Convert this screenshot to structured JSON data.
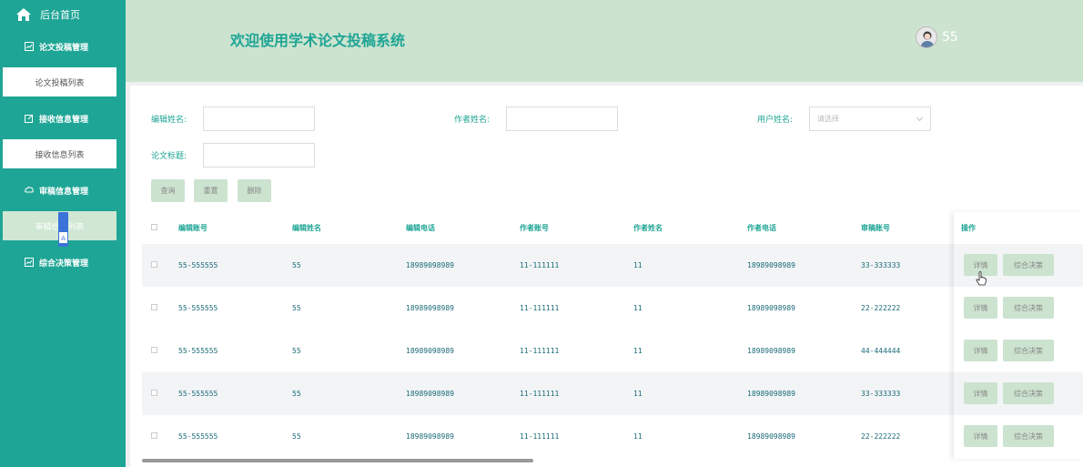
{
  "sidebar": {
    "home": "后台首页",
    "groups": [
      {
        "label": "论文投稿管理",
        "sub": "论文投稿列表"
      },
      {
        "label": "接收信息管理",
        "sub": "接收信息列表"
      },
      {
        "label": "审稿信息管理",
        "sub": "审稿信息列表"
      },
      {
        "label": "综合决策管理"
      }
    ]
  },
  "header": {
    "title": "欢迎使用学术论文投稿系统",
    "username": "55"
  },
  "filters": {
    "editor_name": "编辑姓名:",
    "author_name": "作者姓名:",
    "user_name": "用户姓名:",
    "user_name_placeholder": "请选择",
    "paper_title": "论文标题:"
  },
  "buttons": {
    "query": "查询",
    "reset": "重置",
    "delete": "删除"
  },
  "table": {
    "headers": [
      "编辑账号",
      "编辑姓名",
      "编辑电话",
      "作者账号",
      "作者姓名",
      "作者电话",
      "审稿账号"
    ],
    "ops_header": "操作",
    "detail": "详情",
    "decision": "综合决策",
    "rows": [
      [
        "55-555555",
        "55",
        "18989098989",
        "11-111111",
        "11",
        "18989098989",
        "33-333333"
      ],
      [
        "55-555555",
        "55",
        "18989098989",
        "11-111111",
        "11",
        "18989098989",
        "22-222222"
      ],
      [
        "55-555555",
        "55",
        "18989098989",
        "11-111111",
        "11",
        "18989098989",
        "44-444444"
      ],
      [
        "55-555555",
        "55",
        "18989098989",
        "11-111111",
        "11",
        "18989098989",
        "33-333333"
      ],
      [
        "55-555555",
        "55",
        "18989098989",
        "11-111111",
        "11",
        "18989098989",
        "22-222222"
      ]
    ]
  },
  "colors": {
    "primary": "#1fa595",
    "header_bg": "#cce3cf"
  }
}
